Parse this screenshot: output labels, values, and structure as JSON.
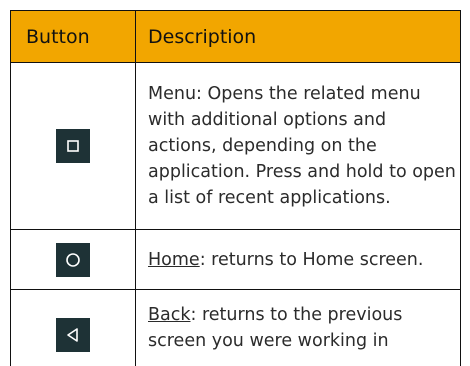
{
  "table": {
    "headers": [
      "Button",
      "Description"
    ],
    "header_color": "#f2a600",
    "icon_bg_color": "#1e3236",
    "rows": [
      {
        "icon": "square-menu-icon",
        "description": " Menu: Opens the related menu with additional options and actions, depending on the application. Press and hold to open a list of recent applications."
      },
      {
        "icon": "circle-home-icon",
        "link_text": "Home",
        "description": ": returns to Home screen."
      },
      {
        "icon": "triangle-back-icon",
        "link_text": "Back",
        "description": ": returns to the previous screen you were working in"
      }
    ]
  }
}
